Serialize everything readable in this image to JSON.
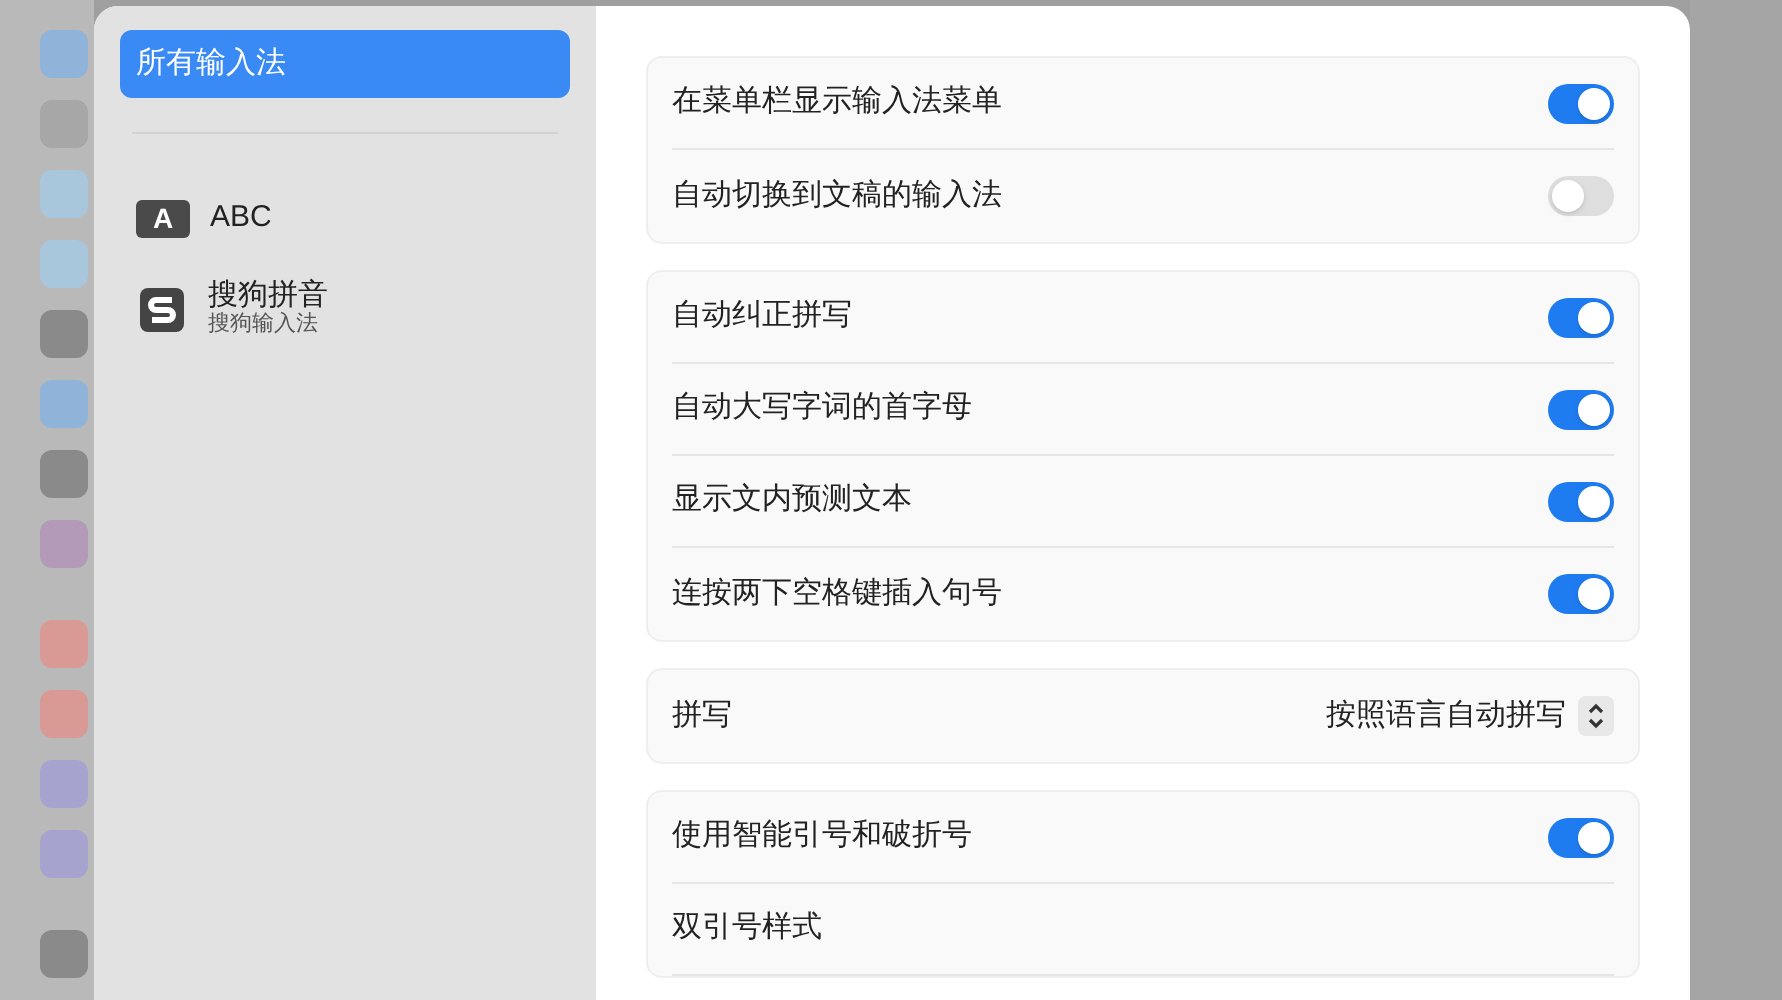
{
  "sidebar": {
    "items": [
      {
        "kind": "all",
        "label": "所有输入法",
        "selected": true
      },
      {
        "kind": "letter",
        "icon_text": "A",
        "label": "ABC",
        "selected": false
      },
      {
        "kind": "logo",
        "label": "搜狗拼音",
        "sublabel": "搜狗输入法",
        "selected": false
      }
    ]
  },
  "groups": [
    {
      "rows": [
        {
          "kind": "toggle",
          "label": "在菜单栏显示输入法菜单",
          "on": true
        },
        {
          "kind": "toggle",
          "label": "自动切换到文稿的输入法",
          "on": false
        }
      ]
    },
    {
      "rows": [
        {
          "kind": "toggle",
          "label": "自动纠正拼写",
          "on": true
        },
        {
          "kind": "toggle",
          "label": "自动大写字词的首字母",
          "on": true
        },
        {
          "kind": "toggle",
          "label": "显示文内预测文本",
          "on": true
        },
        {
          "kind": "toggle",
          "label": "连按两下空格键插入句号",
          "on": true
        }
      ]
    },
    {
      "rows": [
        {
          "kind": "popup",
          "label": "拼写",
          "value": "按照语言自动拼写"
        }
      ]
    },
    {
      "rows": [
        {
          "kind": "toggle",
          "label": "使用智能引号和破折号",
          "on": true
        },
        {
          "kind": "text",
          "label": "双引号样式"
        }
      ]
    }
  ]
}
